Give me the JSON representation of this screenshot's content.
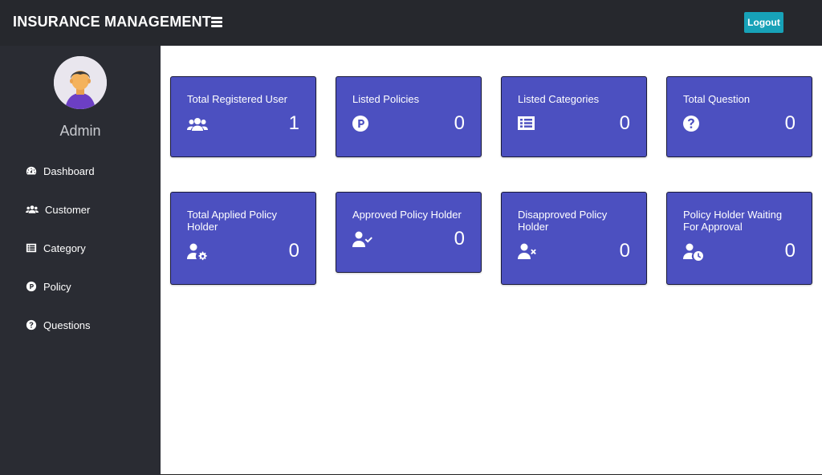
{
  "header": {
    "brand": "INSURANCE MANAGEMENT",
    "logout_label": "Logout",
    "logout_color": "#17a2b8"
  },
  "sidebar": {
    "user_name": "Admin",
    "items": [
      {
        "label": "Dashboard",
        "icon": "dashboard-icon"
      },
      {
        "label": "Customer",
        "icon": "users-icon"
      },
      {
        "label": "Category",
        "icon": "list-icon"
      },
      {
        "label": "Policy",
        "icon": "parking-circle-icon"
      },
      {
        "label": "Questions",
        "icon": "question-circle-icon"
      }
    ]
  },
  "cards": [
    {
      "title": "Total Registered User",
      "count": "1",
      "icon": "users-icon"
    },
    {
      "title": "Listed Policies",
      "count": "0",
      "icon": "parking-circle-icon"
    },
    {
      "title": "Listed Categories",
      "count": "0",
      "icon": "list-icon"
    },
    {
      "title": "Total Question",
      "count": "0",
      "icon": "question-circle-icon"
    },
    {
      "title": "Total Applied Policy Holder",
      "count": "0",
      "icon": "user-cog-icon"
    },
    {
      "title": "Approved Policy Holder",
      "count": "0",
      "icon": "user-check-icon"
    },
    {
      "title": "Disapproved Policy Holder",
      "count": "0",
      "icon": "user-times-icon"
    },
    {
      "title": "Policy Holder Waiting For Approval",
      "count": "0",
      "icon": "user-clock-icon"
    }
  ],
  "colors": {
    "card_bg": "#4c50c0",
    "sidebar_bg": "#2a2c33",
    "topbar_bg": "#26282d"
  }
}
